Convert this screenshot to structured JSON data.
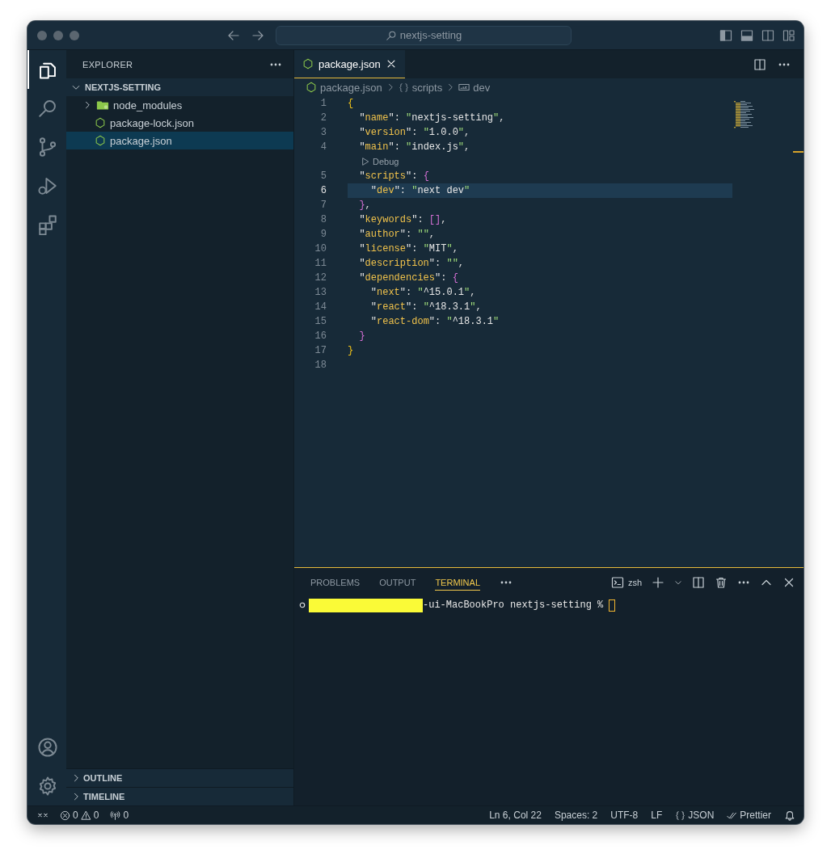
{
  "window": {
    "search": "nextjs-setting"
  },
  "activity_bar": [
    {
      "selected": true
    },
    {
      "selected": false
    },
    {
      "selected": false
    },
    {
      "selected": false
    },
    {
      "selected": false
    }
  ],
  "sidebar": {
    "title": "EXPLORER",
    "folder": {
      "label": "NEXTJS-SETTING",
      "expanded": true,
      "children": [
        {
          "label": "node_modules",
          "kind": "folder",
          "expanded": false,
          "selected": false
        },
        {
          "label": "package-lock.json",
          "kind": "file",
          "selected": false
        },
        {
          "label": "package.json",
          "kind": "file",
          "selected": true
        }
      ]
    },
    "sections": [
      {
        "label": "OUTLINE",
        "expanded": false
      },
      {
        "label": "TIMELINE",
        "expanded": false
      }
    ]
  },
  "editor": {
    "tabs": [
      {
        "label": "package.json",
        "selected": true
      }
    ],
    "breadcrumb": [
      {
        "label": "package.json",
        "kind": "file"
      },
      {
        "label": "scripts",
        "kind": "object"
      },
      {
        "label": "dev",
        "kind": "string"
      }
    ],
    "lines": [
      {
        "kind": "code",
        "number": "1",
        "text": "{",
        "highlighted": false
      },
      {
        "kind": "code",
        "number": "2",
        "text": "  \"name\": \"nextjs-setting\",",
        "highlighted": false
      },
      {
        "kind": "code",
        "number": "3",
        "text": "  \"version\": \"1.0.0\",",
        "highlighted": false
      },
      {
        "kind": "code",
        "number": "4",
        "text": "  \"main\": \"index.js\",",
        "highlighted": false
      },
      {
        "kind": "codelens",
        "text": "Debug"
      },
      {
        "kind": "code",
        "number": "5",
        "text": "  \"scripts\": {",
        "highlighted": false
      },
      {
        "kind": "code",
        "number": "6",
        "text": "    \"dev\": \"next dev\"",
        "highlighted": true
      },
      {
        "kind": "code",
        "number": "7",
        "text": "  },",
        "highlighted": false
      },
      {
        "kind": "code",
        "number": "8",
        "text": "  \"keywords\": [],",
        "highlighted": false
      },
      {
        "kind": "code",
        "number": "9",
        "text": "  \"author\": \"\",",
        "highlighted": false
      },
      {
        "kind": "code",
        "number": "10",
        "text": "  \"license\": \"MIT\",",
        "highlighted": false
      },
      {
        "kind": "code",
        "number": "11",
        "text": "  \"description\": \"\",",
        "highlighted": false
      },
      {
        "kind": "code",
        "number": "12",
        "text": "  \"dependencies\": {",
        "highlighted": false
      },
      {
        "kind": "code",
        "number": "13",
        "text": "    \"next\": \"^15.0.1\",",
        "highlighted": false
      },
      {
        "kind": "code",
        "number": "14",
        "text": "    \"react\": \"^18.3.1\",",
        "highlighted": false
      },
      {
        "kind": "code",
        "number": "15",
        "text": "    \"react-dom\": \"^18.3.1\"",
        "highlighted": false
      },
      {
        "kind": "code",
        "number": "16",
        "text": "  }",
        "highlighted": false
      },
      {
        "kind": "code",
        "number": "17",
        "text": "}",
        "highlighted": false
      },
      {
        "kind": "code",
        "number": "18",
        "highlighted": false
      }
    ]
  },
  "panel": {
    "tabs": [
      {
        "label": "PROBLEMS",
        "selected": false
      },
      {
        "label": "OUTPUT",
        "selected": false
      },
      {
        "label": "TERMINAL",
        "selected": true
      }
    ],
    "shell": "zsh",
    "terminal_line": "-ui-MacBookPro nextjs-setting %"
  },
  "status_bar": {
    "errors": "0",
    "warnings": "0",
    "ports": "0",
    "items": [
      {
        "kind": "text",
        "label": "Ln 6, Col 22"
      },
      {
        "kind": "text",
        "label": "Spaces: 2"
      },
      {
        "kind": "text",
        "label": "UTF-8"
      },
      {
        "kind": "text",
        "label": "LF"
      },
      {
        "kind": "language",
        "label": "JSON"
      },
      {
        "kind": "formatter",
        "label": "Prettier"
      }
    ]
  }
}
